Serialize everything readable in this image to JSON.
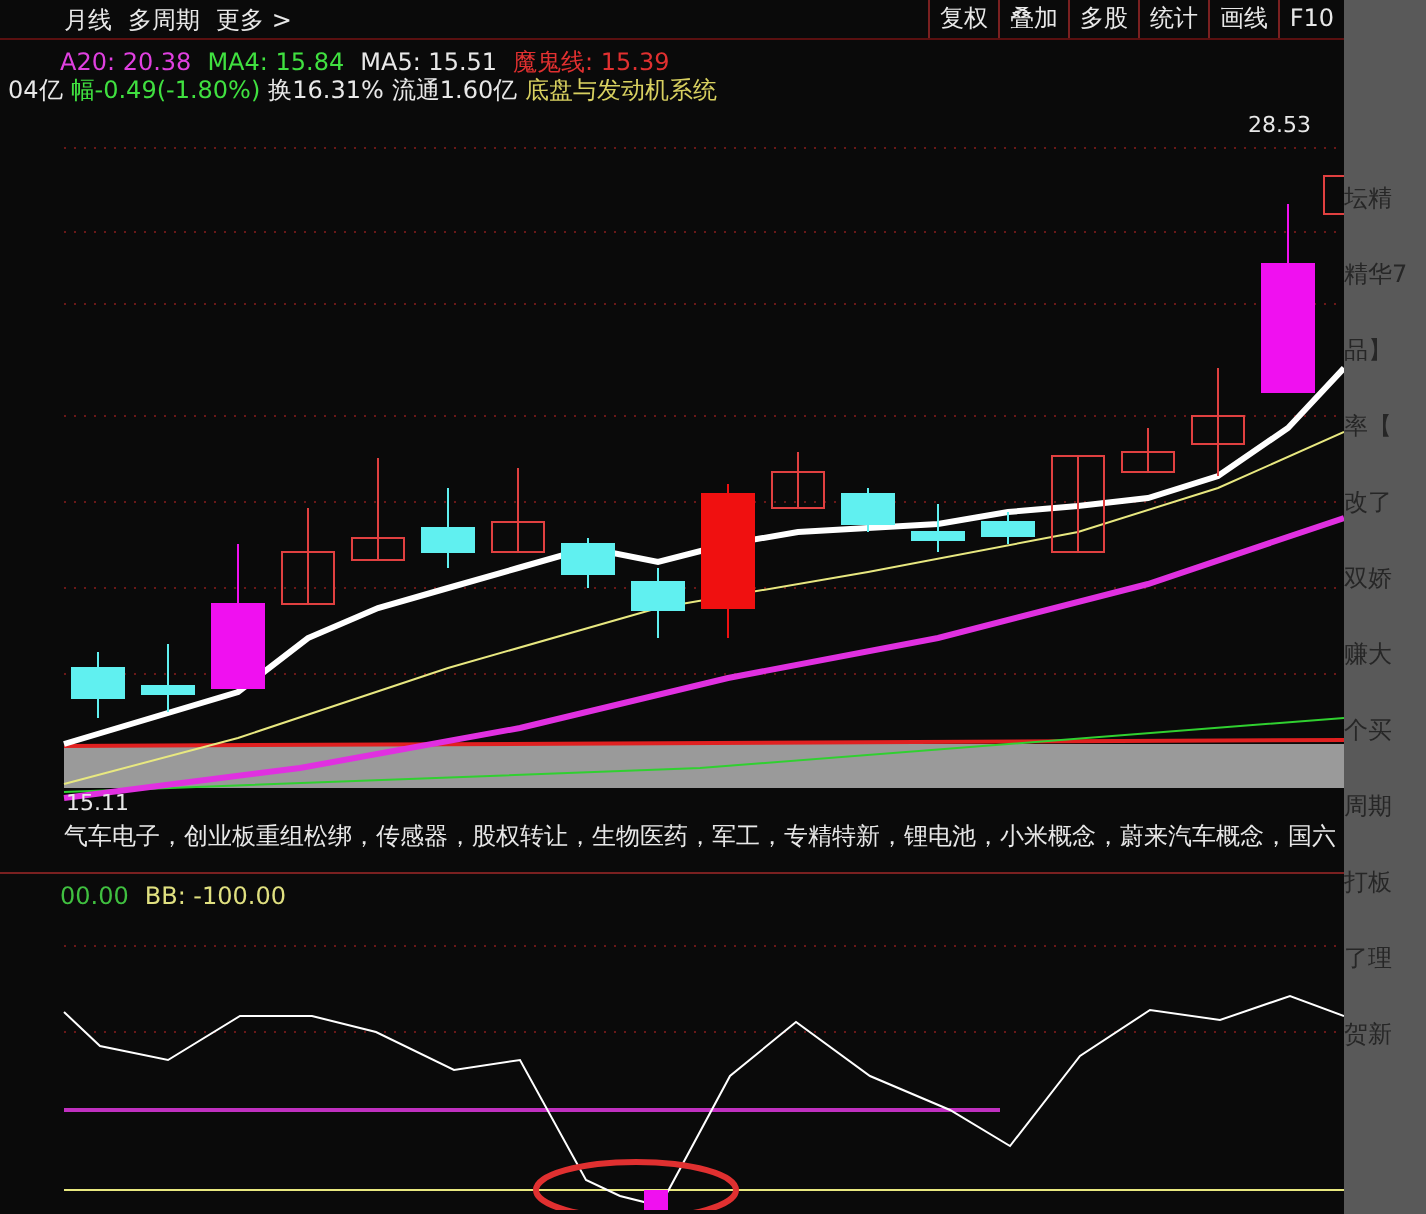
{
  "toolbar": {
    "left_items": [
      "月线",
      "多周期",
      "更多 >"
    ],
    "right_buttons": [
      "复权",
      "叠加",
      "多股",
      "统计",
      "画线",
      "F10"
    ]
  },
  "ma_readouts": [
    {
      "text": "A20: 20.38",
      "color": "#e040e0"
    },
    {
      "text": "MA4: 15.84",
      "color": "#40e040"
    },
    {
      "text": "MA5: 15.51",
      "color": "#e8e8e8"
    },
    {
      "text": "魔鬼线: 15.39",
      "color": "#e03030"
    }
  ],
  "quote_line": [
    {
      "text": "04亿",
      "color": "#e8e8e8"
    },
    {
      "text": "幅-0.49(-1.80%)",
      "color": "#40e040"
    },
    {
      "text": "换16.31%",
      "color": "#e8e8e8"
    },
    {
      "text": "流通1.60亿",
      "color": "#e8e8e8"
    },
    {
      "text": "底盘与发动机系统",
      "color": "#d8d060"
    }
  ],
  "price_labels": {
    "high": "28.53",
    "low": "15.11"
  },
  "concepts": "气车电子，创业板重组松绑，传感器，股权转让，生物医药，军工，专精特新，锂电池，小米概念，蔚来汽车概念，国六",
  "lower_readouts": [
    {
      "text": "00.00",
      "color": "#40c040"
    },
    {
      "text": "BB: -100.00",
      "color": "#e0e080"
    }
  ],
  "background_page": [
    "坛精",
    "精华7",
    "品】",
    "率【",
    "改了",
    "双娇",
    "赚大",
    "个买",
    "周期",
    "打板",
    "了理",
    "贺新"
  ]
}
